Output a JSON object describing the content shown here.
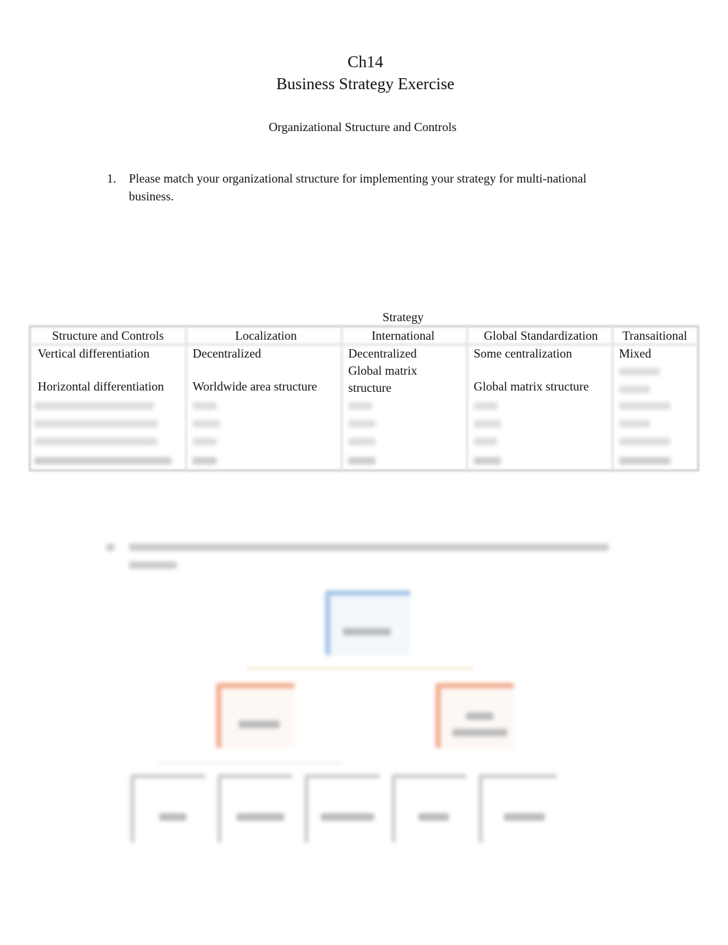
{
  "header": {
    "chapter": "Ch14",
    "title": "Business Strategy Exercise",
    "subtitle": "Organizational Structure and Controls"
  },
  "question1": {
    "number": "1.",
    "text_line1": "Please match your organizational structure for implementing your strategy for multi-national",
    "text_line2": "business."
  },
  "table": {
    "group_header": "Strategy",
    "columns": [
      "Structure and Controls",
      "Localization",
      "International",
      "Global Standardization",
      "Transaitional"
    ],
    "rows": [
      {
        "label": "Vertical differentiation",
        "cells": [
          "Decentralized",
          "Decentralized",
          "Some centralization",
          "Mixed"
        ]
      },
      {
        "label": "Horizontal differentiation",
        "cells": [
          "Worldwide area structure",
          "Global matrix structure",
          "Global matrix structure",
          ""
        ]
      }
    ],
    "blurred_rows": 4
  },
  "colors": {
    "top_box": "#a9c8e8",
    "mid_box": "#f2b093",
    "bottom_box": "#bcbcbc"
  }
}
